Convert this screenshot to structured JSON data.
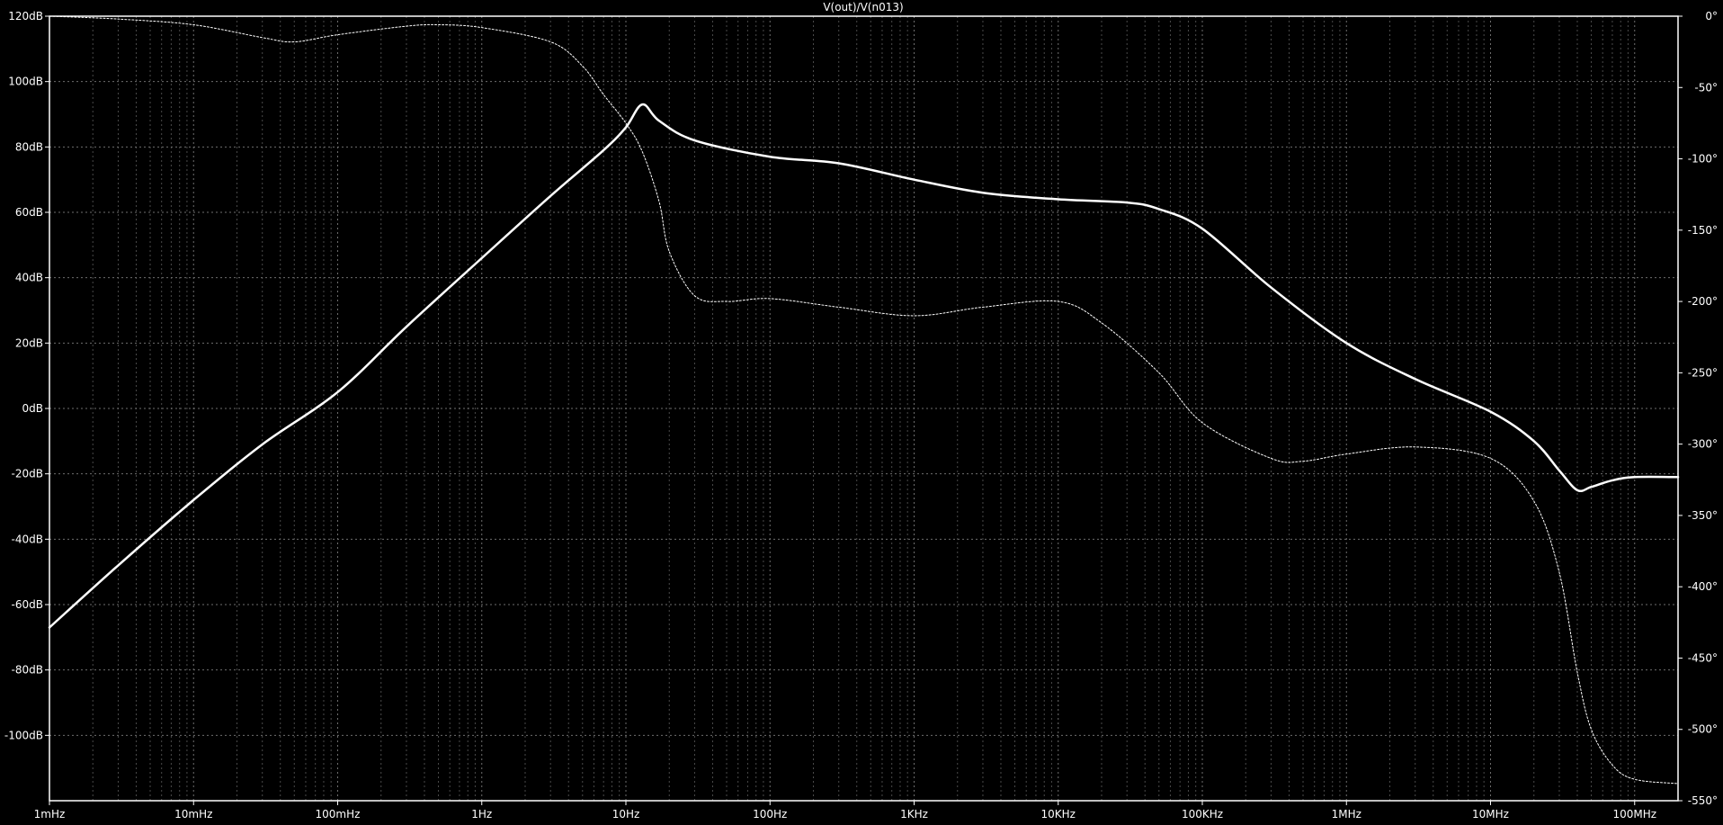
{
  "chart_data": {
    "type": "line",
    "title": "V(out)/V(n013)",
    "xscale": "log",
    "xlim": [
      0.001,
      200000000
    ],
    "ylim": [
      -120,
      120
    ],
    "y2lim": [
      -550,
      0
    ],
    "grid": true,
    "background": "#000000",
    "line_color": "#ffffff",
    "x_ticks": [
      {
        "value": 0.001,
        "label": "1mHz"
      },
      {
        "value": 0.01,
        "label": "10mHz"
      },
      {
        "value": 0.1,
        "label": "100mHz"
      },
      {
        "value": 1,
        "label": "1Hz"
      },
      {
        "value": 10,
        "label": "10Hz"
      },
      {
        "value": 100,
        "label": "100Hz"
      },
      {
        "value": 1000,
        "label": "1KHz"
      },
      {
        "value": 10000,
        "label": "10KHz"
      },
      {
        "value": 100000,
        "label": "100KHz"
      },
      {
        "value": 1000000,
        "label": "1MHz"
      },
      {
        "value": 10000000,
        "label": "10MHz"
      },
      {
        "value": 100000000,
        "label": "100MHz"
      }
    ],
    "y_ticks": [
      {
        "value": 120,
        "label": "120dB"
      },
      {
        "value": 100,
        "label": "100dB"
      },
      {
        "value": 80,
        "label": "80dB"
      },
      {
        "value": 60,
        "label": "60dB"
      },
      {
        "value": 40,
        "label": "40dB"
      },
      {
        "value": 20,
        "label": "20dB"
      },
      {
        "value": 0,
        "label": "0dB"
      },
      {
        "value": -20,
        "label": "-20dB"
      },
      {
        "value": -40,
        "label": "-40dB"
      },
      {
        "value": -60,
        "label": "-60dB"
      },
      {
        "value": -80,
        "label": "-80dB"
      },
      {
        "value": -100,
        "label": "-100dB"
      }
    ],
    "y2_ticks": [
      {
        "value": 0,
        "label": "0°"
      },
      {
        "value": -50,
        "label": "-50°"
      },
      {
        "value": -100,
        "label": "-100°"
      },
      {
        "value": -150,
        "label": "-150°"
      },
      {
        "value": -200,
        "label": "-200°"
      },
      {
        "value": -250,
        "label": "-250°"
      },
      {
        "value": -300,
        "label": "-300°"
      },
      {
        "value": -350,
        "label": "-350°"
      },
      {
        "value": -400,
        "label": "-400°"
      },
      {
        "value": -450,
        "label": "-450°"
      },
      {
        "value": -500,
        "label": "-500°"
      },
      {
        "value": -550,
        "label": "-550°"
      }
    ],
    "series": [
      {
        "axis": "left",
        "style": "solid",
        "x": [
          0.001,
          0.003,
          0.01,
          0.03,
          0.1,
          0.3,
          1,
          3,
          7,
          10,
          13,
          17,
          30,
          100,
          300,
          1000,
          3000,
          10000,
          30000,
          50000,
          100000,
          300000,
          1000000,
          3000000,
          10000000,
          20000000,
          30000000,
          40000000,
          50000000,
          70000000,
          100000000,
          200000000
        ],
        "values": [
          -67,
          -48,
          -28,
          -11,
          5,
          25,
          46,
          65,
          79,
          86,
          93,
          88,
          82,
          77,
          75,
          70,
          66,
          64,
          63,
          61,
          55,
          37,
          20,
          9,
          -1,
          -10,
          -19,
          -25,
          -24,
          -22,
          -21,
          -21
        ]
      },
      {
        "axis": "right",
        "style": "dotted",
        "x": [
          0.001,
          0.003,
          0.01,
          0.03,
          0.05,
          0.1,
          0.3,
          0.5,
          1,
          3,
          5,
          7,
          10,
          13,
          17,
          20,
          30,
          50,
          100,
          300,
          1000,
          3000,
          10000,
          20000,
          50000,
          100000,
          300000,
          500000,
          1000000,
          3000000,
          10000000,
          20000000,
          30000000,
          40000000,
          50000000,
          70000000,
          100000000,
          200000000
        ],
        "values": [
          0,
          -2,
          -6,
          -15,
          -18,
          -13,
          -7,
          -6,
          -8,
          -18,
          -35,
          -55,
          -75,
          -95,
          -130,
          -165,
          -196,
          -200,
          -198,
          -204,
          -210,
          -204,
          -200,
          -215,
          -250,
          -285,
          -310,
          -312,
          -307,
          -302,
          -310,
          -340,
          -390,
          -460,
          -500,
          -525,
          -535,
          -538
        ]
      }
    ]
  }
}
